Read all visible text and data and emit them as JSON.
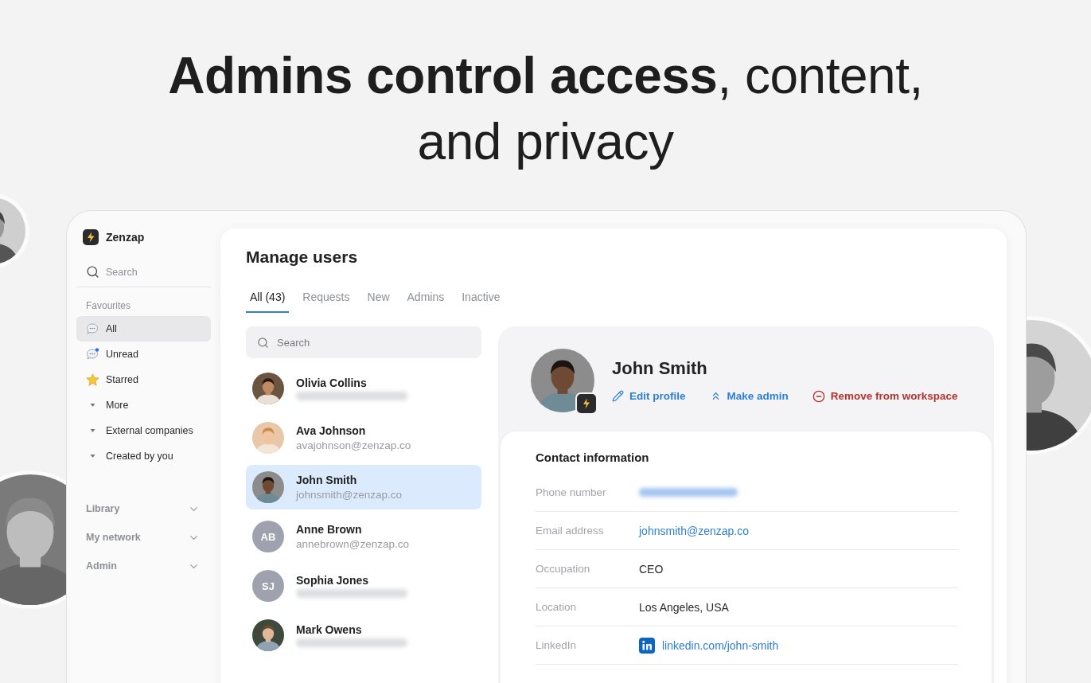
{
  "headline": "**Admins control access**, content, and privacy",
  "sidebar": {
    "app_name": "Zenzap",
    "search_placeholder": "Search",
    "section": "Favourites",
    "items": [
      {
        "label": "All",
        "kind": "chat",
        "selected": true
      },
      {
        "label": "Unread",
        "kind": "unread",
        "selected": false
      },
      {
        "label": "Starred",
        "kind": "star",
        "selected": false
      },
      {
        "label": "More",
        "kind": "folder",
        "selected": false
      },
      {
        "label": "External companies",
        "kind": "folder",
        "selected": false
      },
      {
        "label": "Created by you",
        "kind": "folder",
        "selected": false
      }
    ],
    "groups": [
      "Library",
      "My network",
      "Admin"
    ]
  },
  "page": {
    "title": "Manage users",
    "tabs": [
      {
        "label": "All (43)",
        "selected": true
      },
      {
        "label": "Requests",
        "selected": false
      },
      {
        "label": "New",
        "selected": false
      },
      {
        "label": "Admins",
        "selected": false
      },
      {
        "label": "Inactive",
        "selected": false
      }
    ],
    "search_placeholder": "Search",
    "users": [
      {
        "name": "Olivia Collins",
        "subtitle_blurred": true,
        "selected": false
      },
      {
        "name": "Ava Johnson",
        "subtitle": "avajohnson@zenzap.co",
        "selected": false
      },
      {
        "name": "John Smith",
        "subtitle": "johnsmith@zenzap.co",
        "selected": true
      },
      {
        "name": "Anne Brown",
        "avatar": {
          "kind": "initials",
          "text": "AB"
        },
        "subtitle": "annebrown@zenzap.co",
        "selected": false
      },
      {
        "name": "Sophia Jones",
        "avatar": {
          "kind": "initials",
          "text": "SJ"
        },
        "subtitle_blurred": true,
        "selected": false
      },
      {
        "name": "Mark Owens",
        "subtitle_blurred": true,
        "selected": false
      }
    ],
    "profile": {
      "name": "John Smith",
      "actions": [
        {
          "label": "Edit profile",
          "kind": "edit"
        },
        {
          "label": "Make admin",
          "kind": "promote"
        },
        {
          "label": "Remove from workspace",
          "kind": "remove"
        }
      ],
      "contact_title": "Contact information",
      "fields": [
        {
          "label": "Phone number",
          "kind": "blurred"
        },
        {
          "label": "Email address",
          "kind": "link",
          "value": "johnsmith@zenzap.co"
        },
        {
          "label": "Occupation",
          "kind": "text",
          "value": "CEO"
        },
        {
          "label": "Location",
          "kind": "text",
          "value": "Los Angeles, USA"
        },
        {
          "label": "LinkedIn",
          "kind": "linkedin",
          "value": "linkedin.com/john-smith"
        }
      ]
    }
  }
}
